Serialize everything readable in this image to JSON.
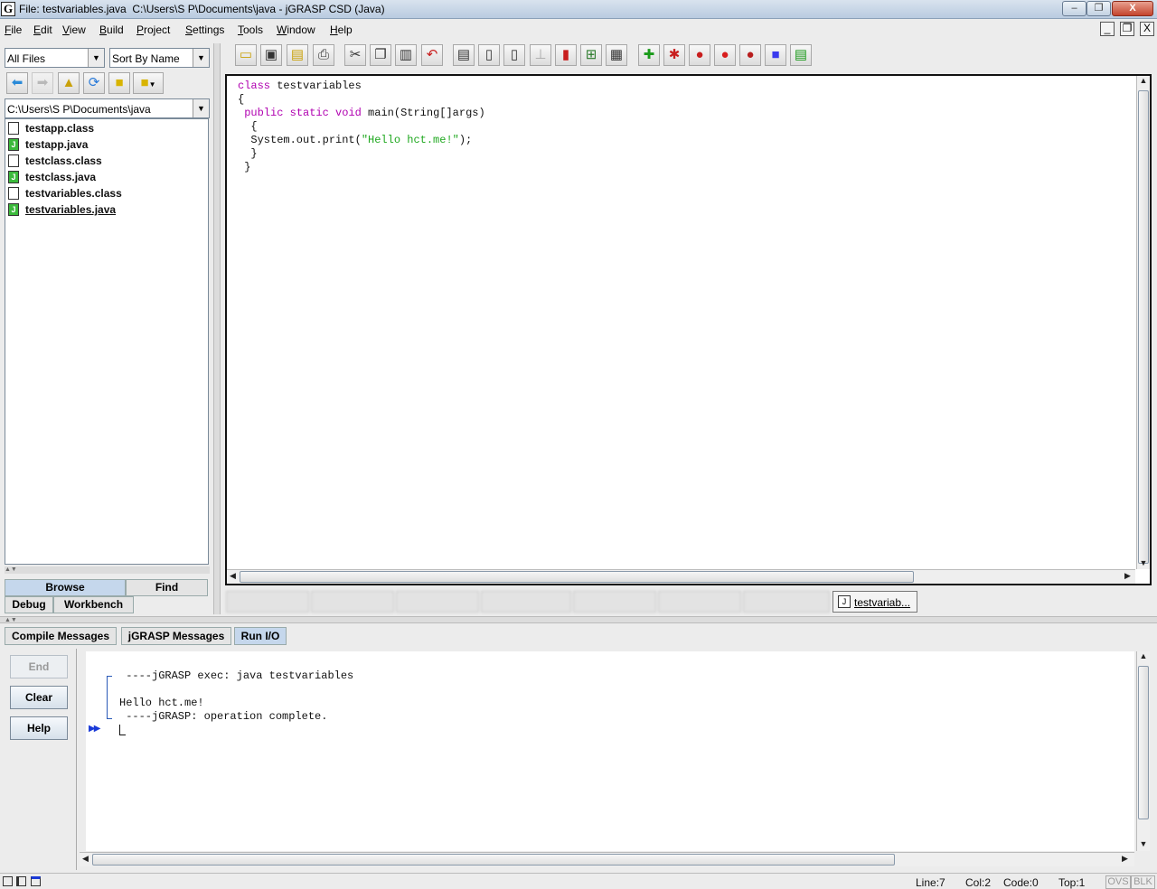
{
  "window": {
    "title": "File: testvariables.java  C:\\Users\\S P\\Documents\\java - jGRASP CSD (Java)",
    "app_icon": "G",
    "minimize": "–",
    "restore": "❐",
    "close": "X",
    "mdi_minimize": "_",
    "mdi_restore": "❐",
    "mdi_close": "X"
  },
  "menubar": [
    "File",
    "Edit",
    "View",
    "Build",
    "Project",
    "Settings",
    "Tools",
    "Window",
    "Help"
  ],
  "browser": {
    "filter": "All Files",
    "sort": "Sort By Name",
    "path": "C:\\Users\\S P\\Documents\\java",
    "toolbar_icons": [
      "back-arrow-icon",
      "forward-arrow-icon",
      "up-folder-icon",
      "refresh-icon",
      "folder-icon",
      "folder-menu-icon"
    ],
    "files": [
      {
        "name": "testapp.class",
        "type": "class"
      },
      {
        "name": "testapp.java",
        "type": "java"
      },
      {
        "name": "testclass.class",
        "type": "class"
      },
      {
        "name": "testclass.java",
        "type": "java"
      },
      {
        "name": "testvariables.class",
        "type": "class"
      },
      {
        "name": "testvariables.java",
        "type": "java",
        "selected": true
      }
    ],
    "java_badge": "J",
    "tabs": {
      "browse": "Browse",
      "find": "Find",
      "debug": "Debug",
      "workbench": "Workbench"
    }
  },
  "toolbar_icons": [
    "open-icon",
    "save-icon",
    "browse-icon",
    "print-icon",
    "cut-icon",
    "copy-icon",
    "paste-icon",
    "undo-icon",
    "csd-icon",
    "clear-csd-icon",
    "line-numbers-icon",
    "pin-icon",
    "uml-icon",
    "tree-icon",
    "book-icon",
    "compile-icon",
    "run-icon",
    "debug-icon",
    "apple-icon",
    "apple-debug-icon",
    "blue-square-icon",
    "split-view-icon"
  ],
  "editor": {
    "code_lines": [
      [
        {
          "t": "class",
          "k": "kw"
        },
        {
          "t": " testvariables",
          "k": ""
        }
      ],
      [
        {
          "t": "{",
          "k": ""
        }
      ],
      [
        {
          "t": " ",
          "k": ""
        },
        {
          "t": "public",
          "k": "kw"
        },
        {
          "t": " ",
          "k": ""
        },
        {
          "t": "static",
          "k": "kw"
        },
        {
          "t": " ",
          "k": ""
        },
        {
          "t": "void",
          "k": "kw"
        },
        {
          "t": " main(String[]args)",
          "k": ""
        }
      ],
      [
        {
          "t": "  {",
          "k": ""
        }
      ],
      [
        {
          "t": "  System.out.print(",
          "k": ""
        },
        {
          "t": "\"Hello hct.me!\"",
          "k": "str"
        },
        {
          "t": ");",
          "k": ""
        }
      ],
      [
        {
          "t": "  }",
          "k": ""
        }
      ],
      [
        {
          "t": " }",
          "k": ""
        }
      ]
    ],
    "active_tab": "testvariab..."
  },
  "bottom": {
    "tabs": [
      "Compile Messages",
      "jGRASP Messages",
      "Run I/O"
    ],
    "active_tab": "Run I/O",
    "buttons": {
      "end": "End",
      "clear": "Clear",
      "help": "Help"
    },
    "output_lines": [
      " ----jGRASP exec: java testvariables",
      "",
      "Hello hct.me!",
      " ----jGRASP: operation complete."
    ],
    "prompt_marker": "▶▶"
  },
  "status": {
    "line": "Line:7",
    "col": "Col:2",
    "code": "Code:0",
    "top": "Top:1",
    "ovs": "OVS",
    "blk": "BLK"
  }
}
